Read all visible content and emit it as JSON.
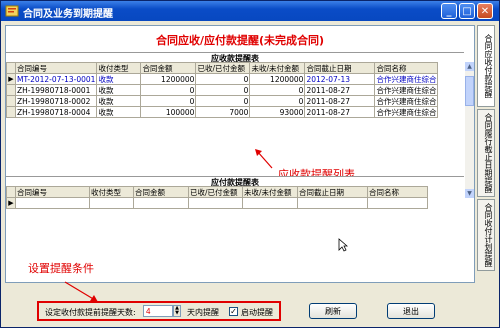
{
  "window": {
    "title": "合同及业务到期提醒",
    "min": "_",
    "max": "□",
    "close": "✕"
  },
  "heading": "合同应收/应付款提醒(未完成合同)",
  "receivable": {
    "section_title": "应收款提醒表",
    "columns": [
      "合同编号",
      "收付类型",
      "合同金额",
      "已收/已付金额",
      "未收/未付金额",
      "合同截止日期",
      "合同名称"
    ],
    "rows": [
      {
        "id": "MT-2012-07-13-0001",
        "type": "收款",
        "amount": "1200000",
        "paid": "0",
        "unpaid": "1200000",
        "date": "2012-07-13",
        "name": "合作兴建商住综合"
      },
      {
        "id": "ZH-19980718-0001",
        "type": "收款",
        "amount": "0",
        "paid": "0",
        "unpaid": "0",
        "date": "2011-08-27",
        "name": "合作兴建商住综合"
      },
      {
        "id": "ZH-19980718-0002",
        "type": "收款",
        "amount": "0",
        "paid": "0",
        "unpaid": "0",
        "date": "2011-08-27",
        "name": "合作兴建商住综合"
      },
      {
        "id": "ZH-19980718-0004",
        "type": "收款",
        "amount": "100000",
        "paid": "7000",
        "unpaid": "93000",
        "date": "2011-08-27",
        "name": "合作兴建商住综合"
      }
    ]
  },
  "payable": {
    "section_title": "应付款提醒表",
    "columns": [
      "合同编号",
      "收付类型",
      "合同金额",
      "已收/已付金额",
      "未收/未付金额",
      "合同截止日期",
      "合同名称"
    ]
  },
  "annotations": {
    "list": "应收款提醒列表",
    "condition": "设置提醒条件"
  },
  "side_tabs": [
    "合同应收付款提醒",
    "合同履行截止日期提醒",
    "合同收付计划提醒"
  ],
  "bottom": {
    "days_label": "设定收付款提前提醒天数:",
    "days_value": "4",
    "days_suffix": "天内提醒",
    "enable_label": "启动提醒",
    "enable_checked": true,
    "refresh_button": "刷新",
    "exit_button": "退出"
  }
}
